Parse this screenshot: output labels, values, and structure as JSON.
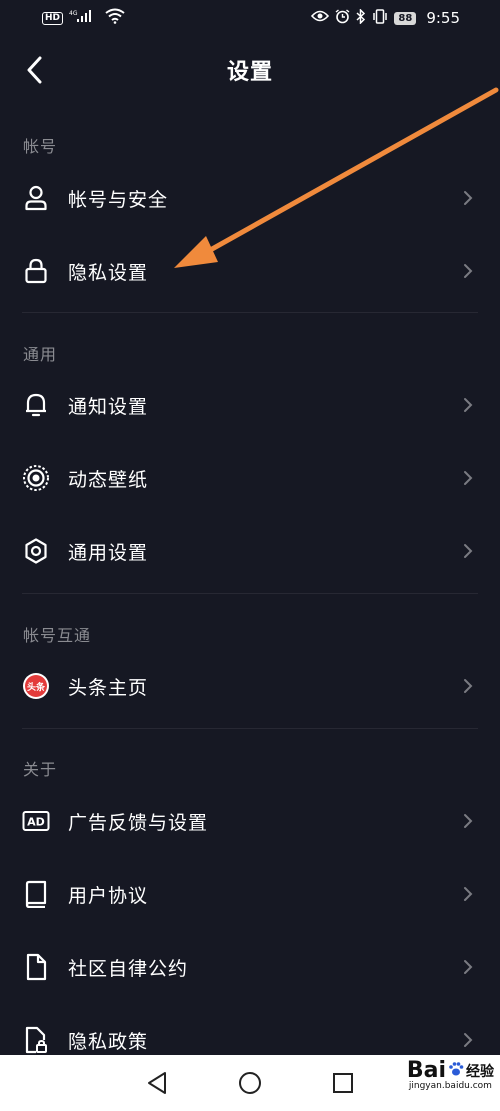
{
  "status_bar": {
    "hd": "HD",
    "network": "4G",
    "battery": "88",
    "time": "9:55"
  },
  "header": {
    "title": "设置"
  },
  "sections": [
    {
      "label": "帐号",
      "items": [
        {
          "label": "帐号与安全",
          "icon": "user-icon"
        },
        {
          "label": "隐私设置",
          "icon": "lock-icon"
        }
      ]
    },
    {
      "label": "通用",
      "items": [
        {
          "label": "通知设置",
          "icon": "bell-icon"
        },
        {
          "label": "动态壁纸",
          "icon": "live-wallpaper-icon"
        },
        {
          "label": "通用设置",
          "icon": "gear-icon"
        }
      ]
    },
    {
      "label": "帐号互通",
      "items": [
        {
          "label": "头条主页",
          "icon": "toutiao-icon",
          "badge": "头条"
        }
      ]
    },
    {
      "label": "关于",
      "items": [
        {
          "label": "广告反馈与设置",
          "icon": "ad-icon",
          "badge": "AD"
        },
        {
          "label": "用户协议",
          "icon": "book-icon"
        },
        {
          "label": "社区自律公约",
          "icon": "document-icon"
        },
        {
          "label": "隐私政策",
          "icon": "privacy-policy-icon"
        }
      ]
    }
  ],
  "annotation": {
    "color": "#f08a3c"
  },
  "watermark": {
    "main": "Bai",
    "sub": "jingyan.baidu.com",
    "cn": "经验"
  },
  "colors": {
    "background": "#161823",
    "section_label": "#8a8b91",
    "divider": "#272833",
    "nav_bar": "#ffffff"
  }
}
